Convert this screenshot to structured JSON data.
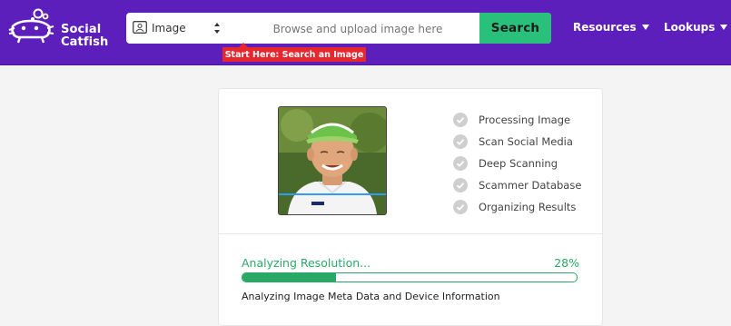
{
  "brand": {
    "name_line1": "Social",
    "name_line2": "Catfish"
  },
  "search": {
    "type_label": "Image",
    "placeholder": "Browse and upload image here",
    "button_label": "Search",
    "hint": "Start Here: Search an Image"
  },
  "nav": [
    {
      "label": "Resources"
    },
    {
      "label": "Lookups"
    }
  ],
  "scan": {
    "steps": [
      {
        "label": "Processing Image",
        "icon": "check-circle-icon"
      },
      {
        "label": "Scan Social Media",
        "icon": "check-circle-icon"
      },
      {
        "label": "Deep Scanning",
        "icon": "check-circle-icon"
      },
      {
        "label": "Scammer Database",
        "icon": "check-circle-icon"
      },
      {
        "label": "Organizing Results",
        "icon": "check-circle-icon"
      }
    ],
    "progress_label": "Analyzing Resolution...",
    "progress_percent_text": "28%",
    "progress_value": 0.28,
    "progress_detail": "Analyzing Image Meta Data and Device Information"
  },
  "colors": {
    "header_bg": "#5d1fbb",
    "search_button": "#29c07c",
    "hint_bg": "#e8262e",
    "progress": "#2aa866",
    "scan_line": "#2f9df5"
  }
}
